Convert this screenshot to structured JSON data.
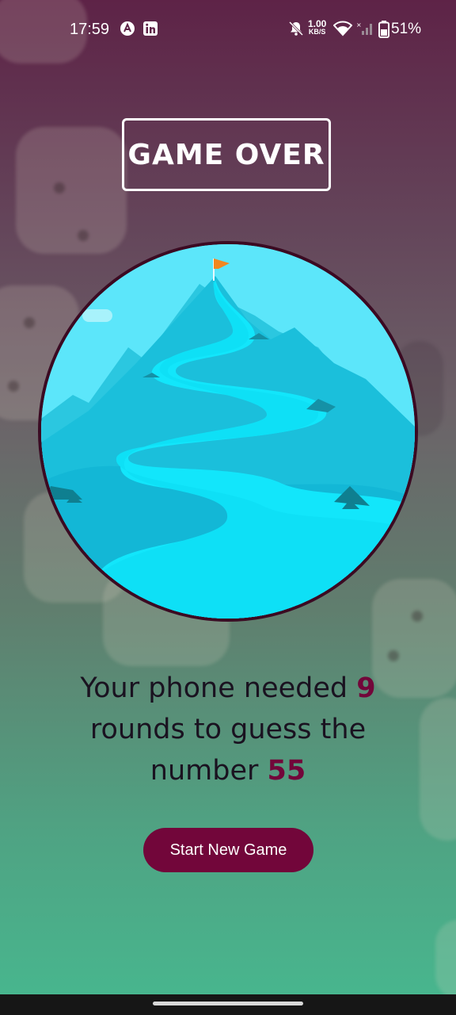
{
  "status_bar": {
    "time": "17:59",
    "net_speed_value": "1.00",
    "net_speed_unit": "KB/S",
    "battery_percent": "51%",
    "icons": [
      "app-a-icon",
      "linkedin-icon",
      "mute-icon",
      "wifi-icon",
      "signal-icon",
      "battery-icon"
    ]
  },
  "screen": {
    "title": "GAME OVER",
    "summary_prefix": "Your phone needed ",
    "rounds": "9",
    "summary_middle": " rounds to guess the number ",
    "number": "55",
    "button_label": "Start New Game"
  },
  "colors": {
    "accent": "#72063a",
    "circle_border": "#3b0a22",
    "sky": "#5ce6fa"
  }
}
